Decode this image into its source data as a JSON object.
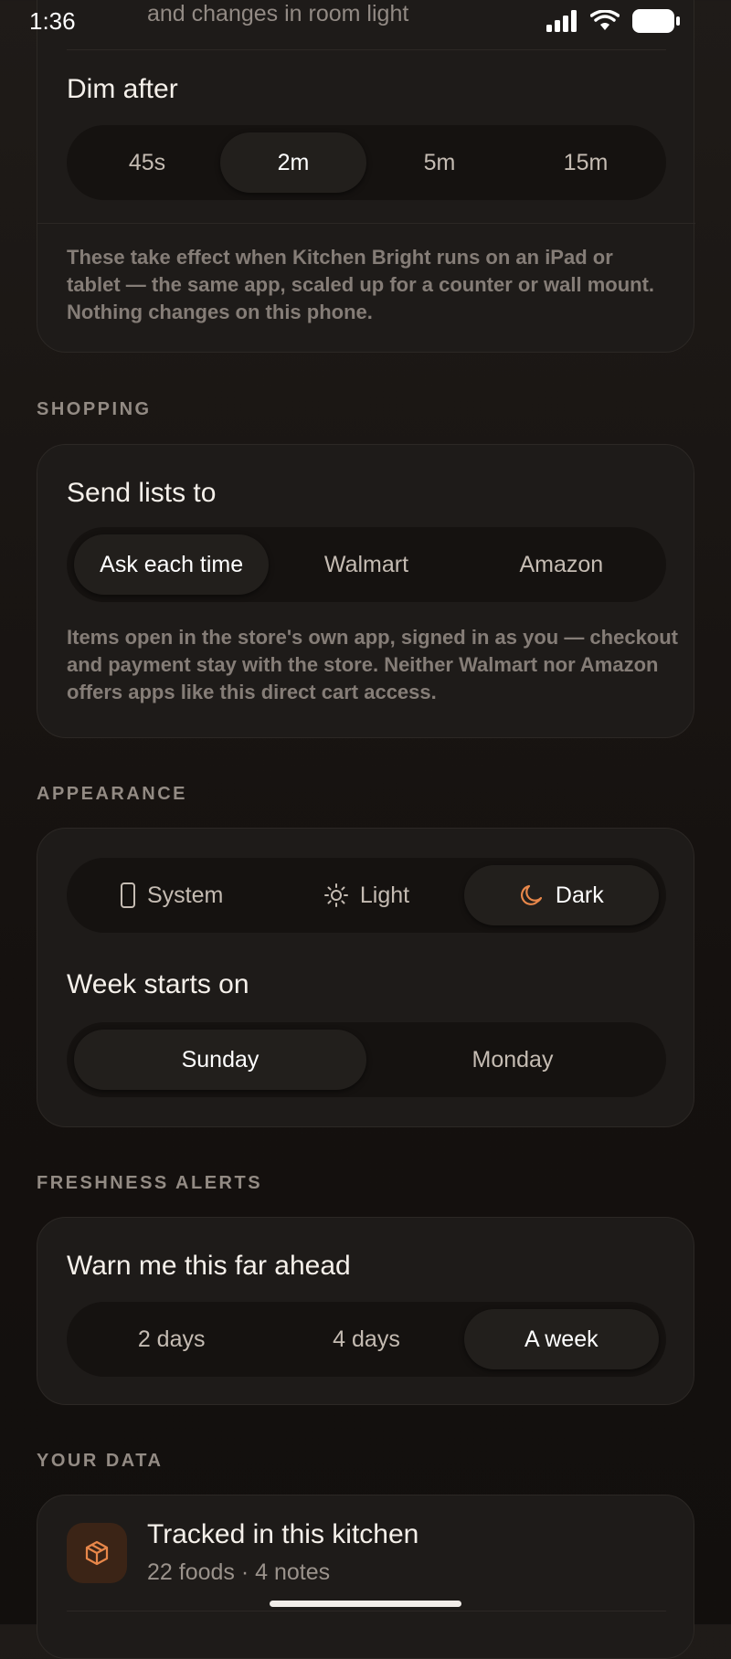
{
  "status_bar": {
    "time": "1:36"
  },
  "top_card": {
    "peek_text": "and changes in room light",
    "dim_after": {
      "title": "Dim after",
      "options": [
        "45s",
        "2m",
        "5m",
        "15m"
      ],
      "selected": "2m"
    },
    "note": "These take effect when Kitchen Bright runs on an iPad or tablet — the same app, scaled up for a counter or wall mount. Nothing changes on this phone."
  },
  "shopping": {
    "header": "SHOPPING",
    "send_lists": {
      "title": "Send lists to",
      "options": [
        "Ask each time",
        "Walmart",
        "Amazon"
      ],
      "selected": "Ask each time"
    },
    "note": "Items open in the store's own app, signed in as you — checkout and payment stay with the store. Neither Walmart nor Amazon offers apps like this direct cart access."
  },
  "appearance": {
    "header": "APPEARANCE",
    "theme": {
      "options": [
        {
          "label": "System",
          "icon": "phone-icon"
        },
        {
          "label": "Light",
          "icon": "sun-icon"
        },
        {
          "label": "Dark",
          "icon": "moon-icon"
        }
      ],
      "selected": "Dark"
    },
    "week_start": {
      "title": "Week starts on",
      "options": [
        "Sunday",
        "Monday"
      ],
      "selected": "Sunday"
    }
  },
  "freshness": {
    "header": "FRESHNESS ALERTS",
    "warn": {
      "title": "Warn me this far ahead",
      "options": [
        "2 days",
        "4 days",
        "A week"
      ],
      "selected": "A week"
    }
  },
  "your_data": {
    "header": "YOUR DATA",
    "tracked": {
      "title": "Tracked in this kitchen",
      "subtitle": "22 foods · 4 notes",
      "icon": "box-icon"
    }
  },
  "colors": {
    "accent": "#e8874a",
    "card": "#1e1b19",
    "segment_track": "#151210",
    "segment_selected": "#221f1c"
  }
}
